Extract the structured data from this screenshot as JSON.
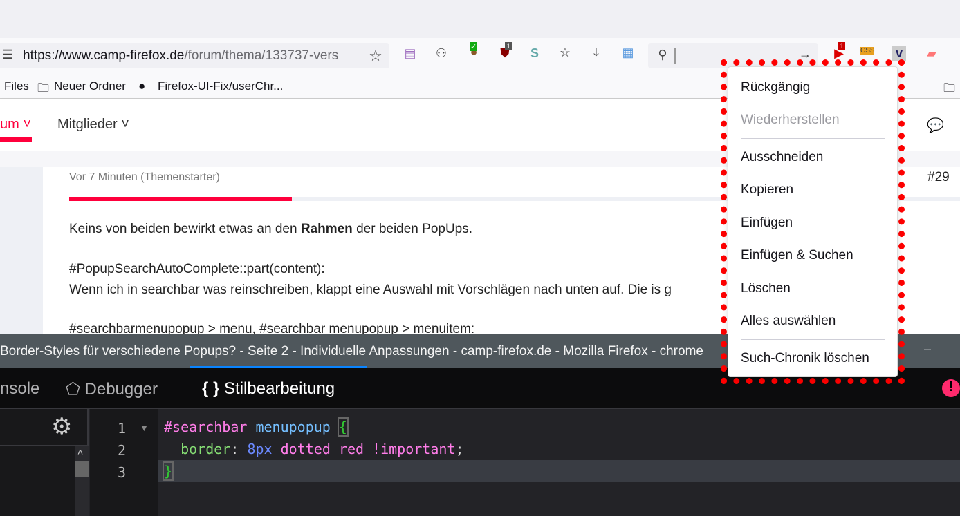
{
  "toolbar": {
    "url_domain": "https://www.camp-firefox.de",
    "url_path": "/forum/thema/133737-vers",
    "badges": {
      "ublock": "1",
      "ext_red": "1"
    }
  },
  "bookmarks": [
    "Files",
    "Neuer Ordner",
    "Firefox-UI-Fix/userChr..."
  ],
  "nav": {
    "forum": "um",
    "members": "Mitglieder"
  },
  "post": {
    "meta": "Vor 7 Minuten (Themenstarter)",
    "number": "#29",
    "progress_percent": 25,
    "lines": [
      "Keins von beiden bewirkt etwas an den ",
      "Rahmen",
      " der beiden PopUps.",
      "#PopupSearchAutoComplete::part(content):",
      "Wenn ich in searchbar was reinschreiben, klappt eine Auswahl mit Vorschlägen nach unten auf. Die is g",
      "#searchbarmenupopup > menu, #searchbar menupopup > menuitem:"
    ]
  },
  "window_title": "Border-Styles für verschiedene Popups? - Seite 2 - Individuelle Anpassungen - camp-firefox.de - Mozilla Firefox - chrome",
  "devtools": {
    "tabs": [
      "nsole",
      "Debugger",
      "Stilbearbeitung"
    ],
    "active": "Stilbearbeitung"
  },
  "editor": {
    "line_numbers": [
      "1",
      "2",
      "3"
    ],
    "code": {
      "selector_id": "#searchbar",
      "selector_el": "menupopup",
      "open": "{",
      "prop": "border",
      "colon": ":",
      "val_num": "8px",
      "val_rest": "dotted red !important",
      "semi": ";",
      "close": "}"
    }
  },
  "context_menu": {
    "items": [
      "Rückgängig",
      "Wiederherstellen",
      "Ausschneiden",
      "Kopieren",
      "Einfügen",
      "Einfügen & Suchen",
      "Löschen",
      "Alles auswählen",
      "Such-Chronik löschen"
    ],
    "disabled": [
      "Wiederherstellen"
    ]
  },
  "colors": {
    "accent": "#ff003c",
    "popup_border": "#ff0000",
    "devtools_tab_underline": "#0a84ff"
  }
}
